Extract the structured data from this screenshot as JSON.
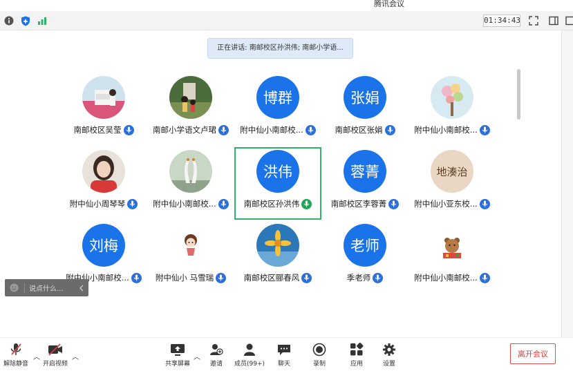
{
  "app_title": "腾讯会议",
  "toolbar": {
    "timer": "01:34:43"
  },
  "speaking": "正在讲话: 南邮校区孙洪伟; 南邮小学语...",
  "participants": [
    {
      "name": "南邮校区吴莹",
      "avatar_text": ""
    },
    {
      "name": "南邮小学语文卢珺",
      "avatar_text": ""
    },
    {
      "name": "附中仙小南邮校...",
      "avatar_text": "博群"
    },
    {
      "name": "南邮校区张娟",
      "avatar_text": "张娟"
    },
    {
      "name": "附中仙小南邮校...",
      "avatar_text": ""
    },
    {
      "name": "附中仙小周琴琴",
      "avatar_text": ""
    },
    {
      "name": "附中仙小南邮校...",
      "avatar_text": ""
    },
    {
      "name": "南邮校区孙洪伟",
      "avatar_text": "洪伟"
    },
    {
      "name": "南邮校区李蓉菁",
      "avatar_text": "蓉菁"
    },
    {
      "name": "附中仙小亚东校...",
      "avatar_text": "地湊治"
    },
    {
      "name": "附中仙小南邮校...",
      "avatar_text": "刘梅"
    },
    {
      "name": "附中仙小 马雪瑞",
      "avatar_text": ""
    },
    {
      "name": "南邮校区郦春风",
      "avatar_text": ""
    },
    {
      "name": "季老师",
      "avatar_text": "老师"
    },
    {
      "name": "附中仙小南邮校...",
      "avatar_text": ""
    }
  ],
  "chat": {
    "placeholder": "说点什么..."
  },
  "bottom": {
    "unmute": "解除静音",
    "start_video": "开启视频",
    "share_screen": "共享屏幕",
    "invite": "邀请",
    "members": "成员(99+)",
    "chat": "聊天",
    "record": "录制",
    "apps": "应用",
    "settings": "设置",
    "leave": "离开会议"
  },
  "colors": {
    "accent": "#1a73e8",
    "active_border": "#2fb36b",
    "leave": "#e03b3b"
  }
}
